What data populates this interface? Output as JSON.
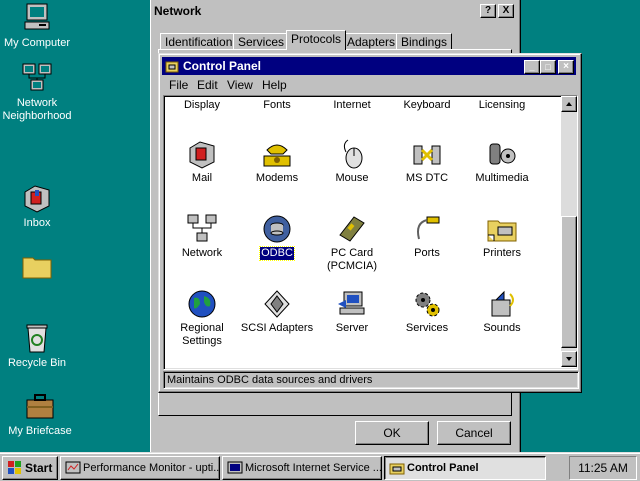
{
  "desktop": {
    "icons": [
      {
        "label": "My Computer"
      },
      {
        "label": "Network Neighborhood"
      },
      {
        "label": "Inbox"
      },
      {
        "label": ""
      },
      {
        "label": "Recycle Bin"
      },
      {
        "label": "My Briefcase"
      }
    ]
  },
  "network_window": {
    "title": "Network",
    "help_btn": "?",
    "close_btn": "X",
    "tabs": [
      "Identification",
      "Services",
      "Protocols",
      "Adapters",
      "Bindings"
    ],
    "active_tab": "Protocols",
    "ok_label": "OK",
    "cancel_label": "Cancel"
  },
  "control_panel": {
    "title": "Control Panel",
    "menu": [
      "File",
      "Edit",
      "View",
      "Help"
    ],
    "items_row0": [
      "Display",
      "Fonts",
      "Internet",
      "Keyboard",
      "Licensing"
    ],
    "items": [
      {
        "label": "Mail",
        "icon": "mail-icon"
      },
      {
        "label": "Modems",
        "icon": "modem-phone-icon"
      },
      {
        "label": "Mouse",
        "icon": "mouse-icon"
      },
      {
        "label": "MS DTC",
        "icon": "msdtc-icon"
      },
      {
        "label": "Multimedia",
        "icon": "multimedia-icon"
      },
      {
        "label": "Network",
        "icon": "network-icon"
      },
      {
        "label": "ODBC",
        "icon": "odbc-icon"
      },
      {
        "label": "PC Card (PCMCIA)",
        "icon": "pccard-icon"
      },
      {
        "label": "Ports",
        "icon": "ports-icon"
      },
      {
        "label": "Printers",
        "icon": "printers-folder-icon"
      },
      {
        "label": "Regional Settings",
        "icon": "globe-icon"
      },
      {
        "label": "SCSI Adapters",
        "icon": "scsi-icon"
      },
      {
        "label": "Server",
        "icon": "server-icon"
      },
      {
        "label": "Services",
        "icon": "gears-icon"
      },
      {
        "label": "Sounds",
        "icon": "speaker-icon"
      }
    ],
    "selected_item": "ODBC",
    "status": "Maintains ODBC data sources and drivers"
  },
  "taskbar": {
    "start_label": "Start",
    "tasks": [
      {
        "label": "Performance Monitor - upti..."
      },
      {
        "label": "Microsoft Internet Service ..."
      },
      {
        "label": "Control Panel"
      }
    ],
    "clock": "11:25 AM"
  },
  "colors": {
    "desktop": "#008080",
    "titlebar_active": "#000080",
    "face": "#c0c0c0"
  }
}
